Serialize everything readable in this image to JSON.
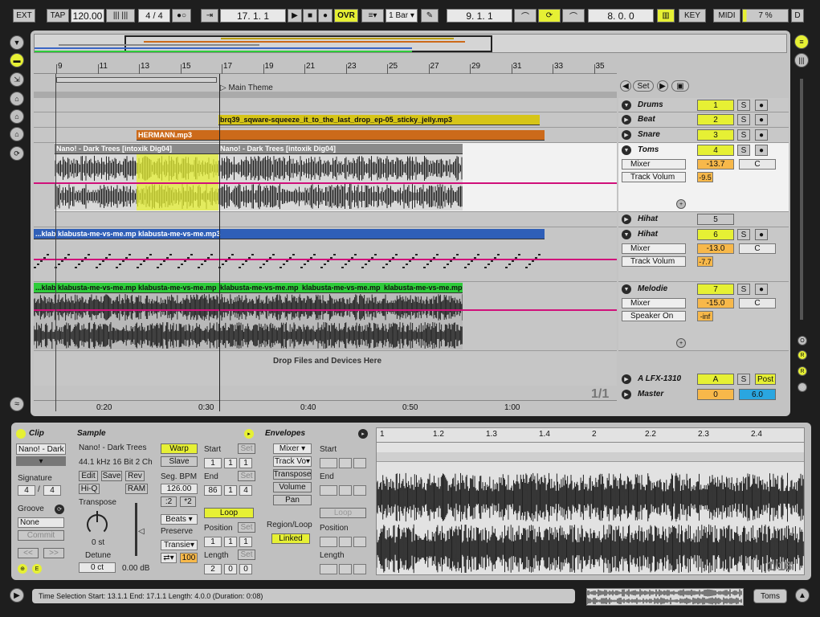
{
  "transport": {
    "ext": "EXT",
    "tap": "TAP",
    "tempo": "120.00",
    "sig_num": "4",
    "sig_den": "4",
    "position": "17. 1. 1",
    "ovr": "OVR",
    "quant": "1 Bar",
    "loop_start": "9. 1. 1",
    "loop_len": "8. 0. 0",
    "key": "KEY",
    "midi": "MIDI",
    "cpu": "7 %",
    "d": "D"
  },
  "ruler": {
    "bars": [
      "9",
      "11",
      "13",
      "15",
      "17",
      "19",
      "21",
      "23",
      "25",
      "27",
      "29",
      "31",
      "33",
      "35"
    ],
    "times": [
      "0:20",
      "0:30",
      "0:40",
      "0:50",
      "1:00"
    ],
    "locator": "Main Theme",
    "pager": "1/1"
  },
  "locators": {
    "set": "Set"
  },
  "clips": {
    "beat": "brq39_sqware-squeeze_it_to_the_last_drop_ep-05_sticky_jelly.mp3",
    "snare": "HERMANN.mp3",
    "toms1": "Nano! - Dark Trees  [intoxik Dig04]",
    "toms2": "Nano! - Dark Trees  [intoxik Dig04]",
    "hihat_a": "...klab",
    "hihat_b": "klabusta-me-vs-me.mp3",
    "hihat_c": "klabusta-me-vs-me.mp3",
    "mel_a": "...klab",
    "mel_b": "klabusta-me-vs-me.mp",
    "mel_c": "klabusta-me-vs-me.mp",
    "mel_d": "klabusta-me-vs-me.mp",
    "mel_e": "klabusta-me-vs-me.mp",
    "mel_f": "klabusta-me-vs-me.mp",
    "drop": "Drop Files and Devices Here"
  },
  "tracks": [
    {
      "name": "Drums",
      "num": "1",
      "s": "S"
    },
    {
      "name": "Beat",
      "num": "2",
      "s": "S"
    },
    {
      "name": "Snare",
      "num": "3",
      "s": "S"
    },
    {
      "name": "Toms",
      "num": "4",
      "s": "S",
      "dev": "Mixer",
      "param": "Track Volum",
      "val": "-13.7",
      "pan": "C",
      "val2": "-9.5"
    },
    {
      "name": "Hihat",
      "num": "5"
    },
    {
      "name": "Hihat",
      "num": "6",
      "s": "S",
      "dev": "Mixer",
      "param": "Track Volum",
      "val": "-13.0",
      "pan": "C",
      "val2": "-7.7"
    },
    {
      "name": "Melodie",
      "num": "7",
      "s": "S",
      "dev": "Mixer",
      "param": "Speaker On",
      "val": "-15.0",
      "pan": "C",
      "val2": "-inf"
    }
  ],
  "returns": {
    "name": "A LFX-1310",
    "letter": "A",
    "s": "S",
    "post": "Post",
    "master": "Master",
    "master_vol": "0",
    "master_pan": "6.0"
  },
  "clip": {
    "title": "Clip",
    "name": "Nano! - Dark",
    "signature": "Signature",
    "sig_n": "4",
    "sig_d": "4",
    "groove": "Groove",
    "groove_val": "None",
    "commit": "Commit"
  },
  "sample": {
    "title": "Sample",
    "name": "Nano! - Dark Trees",
    "info": "44.1 kHz 16 Bit 2 Ch",
    "edit": "Edit",
    "save": "Save",
    "rev": "Rev",
    "hiq": "Hi-Q",
    "ram": "RAM",
    "transpose": "Transpose",
    "st": "0 st",
    "detune": "Detune",
    "ct": "0 ct",
    "db": "0.00 dB",
    "warp": "Warp",
    "slave": "Slave",
    "segbpm": "Seg. BPM",
    "bpm": "126.00",
    "half": ":2",
    "dbl": "*2",
    "preserve": "Preserve",
    "beats": "Beats",
    "transie": "Transie",
    "pct": "100",
    "start": "Start",
    "end": "End",
    "loop": "Loop",
    "position": "Position",
    "length": "Length",
    "set": "Set",
    "start_v": [
      "1",
      "1",
      "1"
    ],
    "end_v": [
      "86",
      "1",
      "4"
    ],
    "pos_v": [
      "1",
      "1",
      "1"
    ],
    "len_v": [
      "2",
      "0",
      "0"
    ]
  },
  "envelopes": {
    "title": "Envelopes",
    "mixer": "Mixer",
    "trackv": "Track Vo",
    "transpose": "Transpose",
    "volume": "Volume",
    "pan": "Pan",
    "region": "Region/Loop",
    "linked": "Linked",
    "start": "Start",
    "end": "End",
    "loop": "Loop",
    "position": "Position",
    "length": "Length"
  },
  "editor": {
    "ticks": [
      "1",
      "1.2",
      "1.3",
      "1.4",
      "2",
      "2.2",
      "2.3",
      "2.4"
    ],
    "pager": "1/16"
  },
  "status": {
    "text": "Time Selection    Start: 13.1.1    End: 17.1.1    Length: 4.0.0  (Duration: 0:08)",
    "track": "Toms"
  }
}
